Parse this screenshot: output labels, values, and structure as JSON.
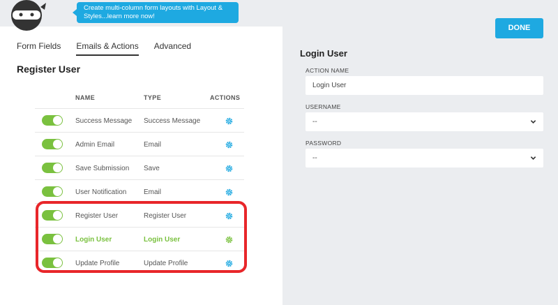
{
  "tooltip": {
    "text": "Create multi-column form layouts with Layout & Styles...learn more now!"
  },
  "tabs": [
    {
      "label": "Form Fields"
    },
    {
      "label": "Emails & Actions"
    },
    {
      "label": "Advanced"
    }
  ],
  "form_title": "Register User",
  "table": {
    "headers": {
      "name": "NAME",
      "type": "TYPE",
      "actions": "ACTIONS"
    },
    "rows": [
      {
        "name": "Success Message",
        "type": "Success Message",
        "enabled": true
      },
      {
        "name": "Admin Email",
        "type": "Email",
        "enabled": true
      },
      {
        "name": "Save Submission",
        "type": "Save",
        "enabled": true
      },
      {
        "name": "User Notification",
        "type": "Email",
        "enabled": true
      },
      {
        "name": "Register User",
        "type": "Register User",
        "enabled": true
      },
      {
        "name": "Login User",
        "type": "Login User",
        "enabled": true
      },
      {
        "name": "Update Profile",
        "type": "Update Profile",
        "enabled": true
      }
    ]
  },
  "done_label": "DONE",
  "action_panel": {
    "title": "Login User",
    "action_name_label": "ACTION NAME",
    "action_name_value": "Login User",
    "username_label": "USERNAME",
    "username_value": "--",
    "password_label": "PASSWORD",
    "password_value": "--"
  },
  "colors": {
    "accent": "#1ea9e1",
    "toggle_on": "#7ac13f",
    "highlight": "#e8262a"
  }
}
